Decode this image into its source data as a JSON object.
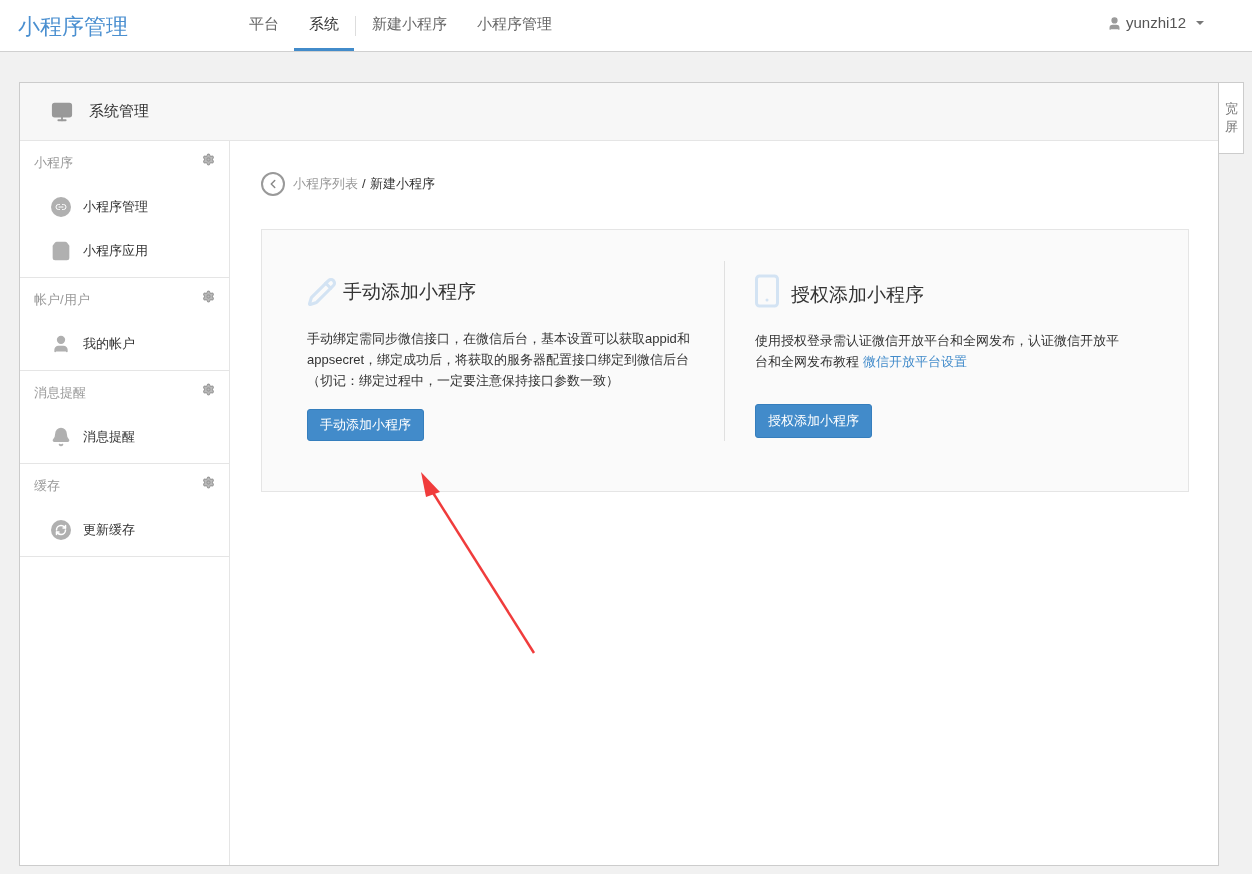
{
  "brand": "小程序管理",
  "nav": [
    {
      "label": "平台",
      "selected": false
    },
    {
      "label": "系统",
      "selected": true
    },
    {
      "label": "新建小程序",
      "selected": false
    },
    {
      "label": "小程序管理",
      "selected": false
    }
  ],
  "user": {
    "name": "yunzhi12"
  },
  "wide_screen": "宽屏",
  "panel": {
    "title": "系统管理"
  },
  "sidebar": [
    {
      "title": "小程序",
      "items": [
        {
          "label": "小程序管理",
          "kind": "miniprogram"
        },
        {
          "label": "小程序应用",
          "kind": "app"
        }
      ]
    },
    {
      "title": "帐户/用户",
      "items": [
        {
          "label": "我的帐户",
          "kind": "account"
        }
      ]
    },
    {
      "title": "消息提醒",
      "items": [
        {
          "label": "消息提醒",
          "kind": "bell"
        }
      ]
    },
    {
      "title": "缓存",
      "items": [
        {
          "label": "更新缓存",
          "kind": "refresh"
        }
      ]
    }
  ],
  "breadcrumb": {
    "parent": "小程序列表",
    "separator": "/",
    "current": "新建小程序"
  },
  "options": [
    {
      "kind": "manual",
      "title": "手动添加小程序",
      "description": "手动绑定需同步微信接口，在微信后台，基本设置可以获取appid和appsecret，绑定成功后，将获取的服务器配置接口绑定到微信后台（切记：绑定过程中，一定要注意保持接口参数一致）",
      "button": "手动添加小程序"
    },
    {
      "kind": "authorize",
      "title": "授权添加小程序",
      "description": "使用授权登录需认证微信开放平台和全网发布，认证微信开放平台和全网发布教程",
      "link": "微信开放平台设置",
      "button": "授权添加小程序"
    }
  ]
}
